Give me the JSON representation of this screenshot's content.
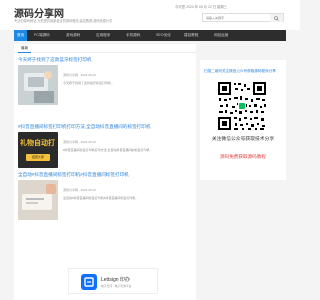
{
  "header": {
    "logo": "源码分享网",
    "slogan": "专业的源码网站,为您提供最新最全的源码程序,建站教程,源码资源分享",
    "topinfo": "今天是 2024 年 05 月 22 日 星期三",
    "search_placeholder": "请输入关键字"
  },
  "nav": [
    {
      "label": "首页",
      "active": true
    },
    {
      "label": "PC端源码"
    },
    {
      "label": "游戏源码"
    },
    {
      "label": "应用程序"
    },
    {
      "label": "手机源码"
    },
    {
      "label": "SEO优化"
    },
    {
      "label": "建站教程"
    },
    {
      "label": "网站运营"
    }
  ],
  "main": {
    "tab": "最新",
    "posts": [
      {
        "title": "今天终于找到了这款蓝牙标签打印机",
        "meta": "源码分享网 · 2024-05-22",
        "excerpt": "今天终于找到了这款蓝牙标签打印机..."
      },
      {
        "title": "#抖音直播间标签打印机打印方法,全自动抖音直播间的标签打印机",
        "meta": "源码分享网 · 2024-05-22",
        "excerpt": "#抖音直播间标签打印机打印方法,全自动抖音直播间的标签打印机...",
        "thumb_text": "礼物自动打",
        "thumb_sub": "招募大家"
      },
      {
        "title": "全自动#抖音直播间标签打印机#抖音直播间标签打印机",
        "meta": "源码分享网 · 2024-05-22",
        "excerpt": "全自动#抖音直播间标签打印机#抖音直播间标签打印机..."
      }
    ]
  },
  "sidebar": {
    "title": "扫描二维码关注微信公众号获取源码程序分享",
    "text1": "关注微信公众号获取技术分享",
    "text2": "源码免费获取源码教程"
  },
  "ad": {
    "name": "Lettsign 印办",
    "sub": "电子合同 · 电子签章平台"
  },
  "colors": {
    "nav_bg": "#2d2d2d",
    "accent": "#1e88e5",
    "link": "#2a82d9",
    "highlight": "#e53935"
  }
}
